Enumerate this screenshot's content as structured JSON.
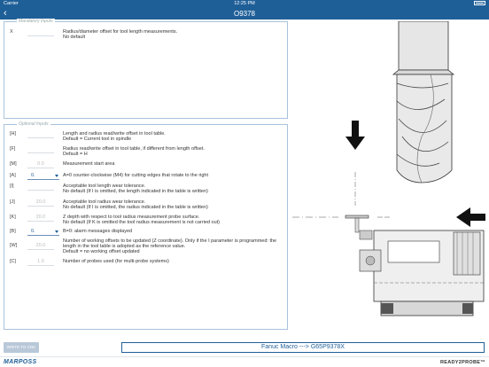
{
  "status_bar": {
    "carrier": "Carrier",
    "time": "12:25 PM"
  },
  "nav": {
    "back_glyph": "‹",
    "title": "O9378"
  },
  "mandatory": {
    "legend": "Mandatory Inputs",
    "params": [
      {
        "key": "X",
        "value": "",
        "desc": "Radius/diameter offset for tool length measurements.\nNo default"
      }
    ]
  },
  "optional": {
    "legend": "Optional Inputs",
    "params": [
      {
        "key": "[H]",
        "value": "",
        "desc": "Length and radius read/write offset in tool table.\nDefault = Current tool in spindle"
      },
      {
        "key": "[F]",
        "value": "",
        "desc": "Radius read/write offset in tool table, if different from length offset.\nDefault = H"
      },
      {
        "key": "[M]",
        "value": "0.0",
        "desc": "Measurement start area"
      },
      {
        "key": "[A]",
        "value": "0.",
        "desc": "A=0 counter-clockwise (M4) for cutting edges that rotate to the right",
        "select": true
      },
      {
        "key": "[I]",
        "value": "",
        "desc": "Acceptable tool length wear tolerance.\nNo default (If I is omitted, the length indicated in the table is written)"
      },
      {
        "key": "[J]",
        "value": "20.0",
        "desc": "Acceptable tool radius wear tolerance.\nNo default (If I is omitted, the radius indicated in the table is written)"
      },
      {
        "key": "[K]",
        "value": "20.0",
        "desc": "Z depth with respect to tool radius measurement probe surface.\nNo default (If K is omitted the tool radius measurement is not carried out)"
      },
      {
        "key": "[B]",
        "value": "0.",
        "desc": "B=0: alarm messages displayed",
        "select": true
      },
      {
        "key": "[W]",
        "value": "20.0",
        "desc": "Number of working offsets to be updated (Z coordinate). Only if the I parameter is programmed: the length in the tool table is adopted as the reference value.\nDefault = no working offset updated"
      },
      {
        "key": "[C]",
        "value": "1.0",
        "desc": "Number of probes used (for multi-probe systems)"
      }
    ]
  },
  "actions": {
    "write_label": "WRITE TO CNC"
  },
  "macro": {
    "text": "Fanuc Macro  ---> G65P9378X"
  },
  "footer": {
    "left_logo": "MARPOSS",
    "right_logo": "READY2PROBE™"
  },
  "colors": {
    "brand_blue": "#1f5f98",
    "border": "#a9c2dc"
  }
}
